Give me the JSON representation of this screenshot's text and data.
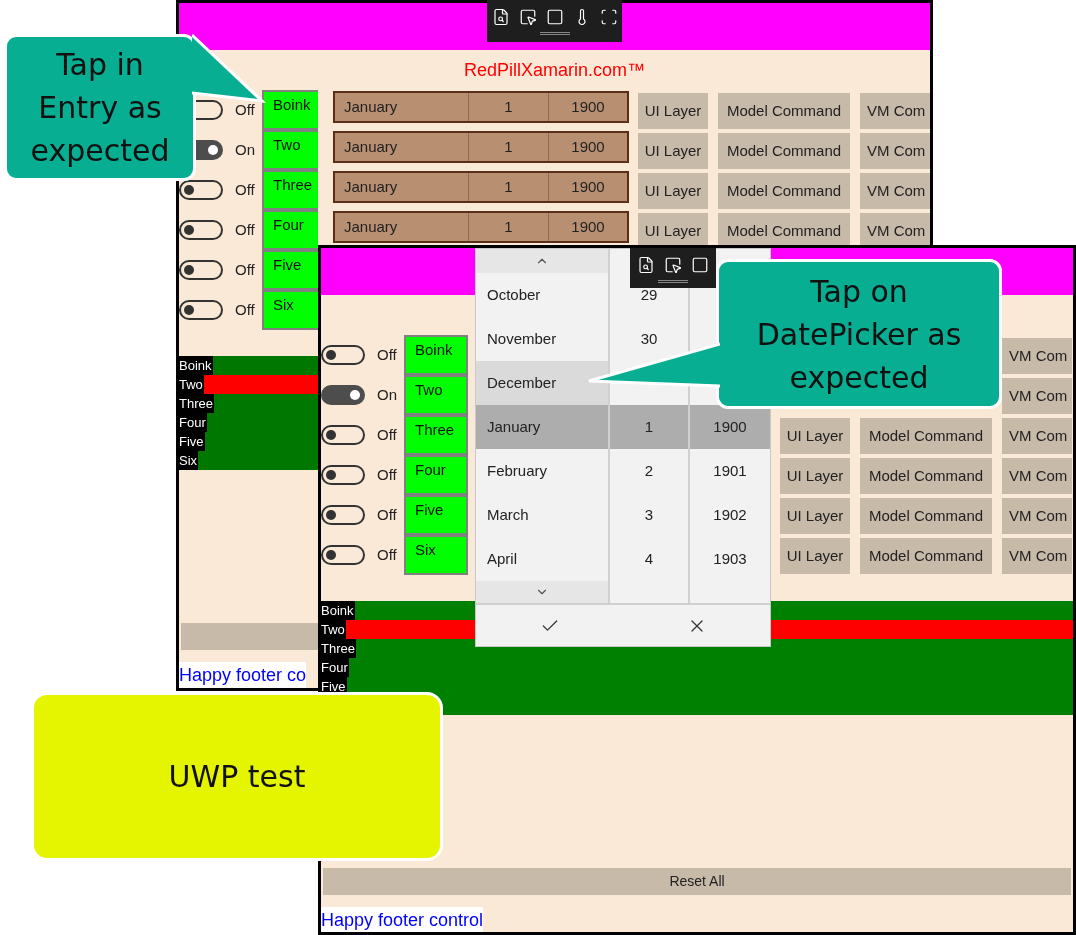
{
  "windows": [
    {
      "title": "RedPillXamarin.com™",
      "rows": [
        {
          "switch_on": false,
          "switch_label": "Off",
          "entry": "Boink",
          "month": "January",
          "day": "1",
          "year": "1900",
          "button_1": "UI Layer",
          "button_2": "Model Command",
          "button_3": "VM Com"
        },
        {
          "switch_on": true,
          "switch_label": "On",
          "entry": "Two",
          "month": "January",
          "day": "1",
          "year": "1900",
          "button_1": "UI Layer",
          "button_2": "Model Command",
          "button_3": "VM Com"
        },
        {
          "switch_on": false,
          "switch_label": "Off",
          "entry": "Three",
          "month": "January",
          "day": "1",
          "year": "1900",
          "button_1": "UI Layer",
          "button_2": "Model Command",
          "button_3": "VM Com"
        },
        {
          "switch_on": false,
          "switch_label": "Off",
          "entry": "Four",
          "month": "January",
          "day": "1",
          "year": "1900",
          "button_1": "UI Layer",
          "button_2": "Model Command",
          "button_3": "VM Com"
        },
        {
          "switch_on": false,
          "switch_label": "Off",
          "entry": "Five"
        },
        {
          "switch_on": false,
          "switch_label": "Off",
          "entry": "Six"
        }
      ],
      "bars": [
        {
          "label": "Boink",
          "color": "#007800"
        },
        {
          "label": "Two",
          "color": "#ff0000"
        },
        {
          "label": "Three",
          "color": "#007800"
        },
        {
          "label": "Four",
          "color": "#007800"
        },
        {
          "label": "Five",
          "color": "#007800"
        },
        {
          "label": "Six",
          "color": "#007800"
        }
      ],
      "reset_button": true,
      "footer": "Happy footer co"
    },
    {
      "rows": [
        {
          "switch_on": false,
          "switch_label": "Off",
          "entry": "Boink",
          "button_3": "VM Com"
        },
        {
          "switch_on": true,
          "switch_label": "On",
          "entry": "Two",
          "button_3": "VM Com"
        },
        {
          "switch_on": false,
          "switch_label": "Off",
          "entry": "Three",
          "button_1": "UI Layer",
          "button_2": "Model Command",
          "button_3": "VM Com"
        },
        {
          "switch_on": false,
          "switch_label": "Off",
          "entry": "Four",
          "button_1": "UI Layer",
          "button_2": "Model Command",
          "button_3": "VM Com"
        },
        {
          "switch_on": false,
          "switch_label": "Off",
          "entry": "Five",
          "button_1": "UI Layer",
          "button_2": "Model Command",
          "button_3": "VM Com"
        },
        {
          "switch_on": false,
          "switch_label": "Off",
          "entry": "Six",
          "button_1": "UI Layer",
          "button_2": "Model Command",
          "button_3": "VM Com"
        }
      ],
      "bars": [
        {
          "label": "Boink",
          "color": "#008000"
        },
        {
          "label": "Two",
          "color": "#ff0000"
        },
        {
          "label": "Three",
          "color": "#008000"
        },
        {
          "label": "Four",
          "color": "#008000"
        },
        {
          "label": "Five",
          "color": "#008000"
        },
        {
          "color": "#008000"
        }
      ],
      "reset_button": "Reset All",
      "footer": "Happy footer control"
    }
  ],
  "date_picker": {
    "rows": [
      {
        "month": "October",
        "day": "29",
        "selected": false
      },
      {
        "month": "November",
        "day": "30",
        "selected": false
      },
      {
        "month": "December",
        "selected": false,
        "hovered": true
      },
      {
        "month": "January",
        "day": "1",
        "year": "1900",
        "selected": true
      },
      {
        "month": "February",
        "day": "2",
        "year": "1901",
        "selected": false
      },
      {
        "month": "March",
        "day": "3",
        "year": "1902",
        "selected": false
      },
      {
        "month": "April",
        "day": "4",
        "year": "1903",
        "selected": false
      }
    ]
  },
  "callouts": [
    {
      "text": "Tap in Entry as expected",
      "color": "#07ae92"
    },
    {
      "text": "Tap on DatePicker as expected",
      "color": "#07ae92"
    },
    {
      "text": "UWP test",
      "color": "#e5f500"
    }
  ]
}
